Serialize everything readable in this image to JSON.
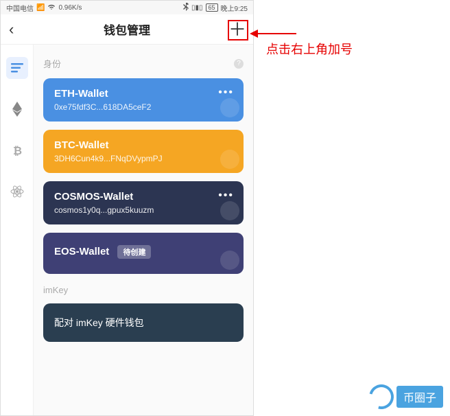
{
  "statusBar": {
    "carrier": "中国电信",
    "netSpeed": "0.96K/s",
    "battery": "65",
    "time": "晚上9:25"
  },
  "nav": {
    "title": "钱包管理",
    "backGlyph": "‹",
    "addGlyph": "＋"
  },
  "sections": {
    "identity": "身份",
    "imkey": "imKey"
  },
  "wallets": [
    {
      "name": "ETH-Wallet",
      "address": "0xe75fdf3C...618DA5ceF2",
      "color": "#4a90e2",
      "more": true
    },
    {
      "name": "BTC-Wallet",
      "address": "3DH6Cun4k9...FNqDVypmPJ",
      "color": "#f5a623",
      "more": false
    },
    {
      "name": "COSMOS-Wallet",
      "address": "cosmos1y0q...gpux5kuuzm",
      "color": "#2c3552",
      "more": true
    },
    {
      "name": "EOS-Wallet",
      "address": "",
      "badge": "待创建",
      "color": "#3f4075",
      "more": false
    }
  ],
  "hardware": {
    "label": "配对 imKey 硬件钱包"
  },
  "annotation": {
    "text": "点击右上角加号"
  },
  "watermark": {
    "text": "币圈子"
  }
}
